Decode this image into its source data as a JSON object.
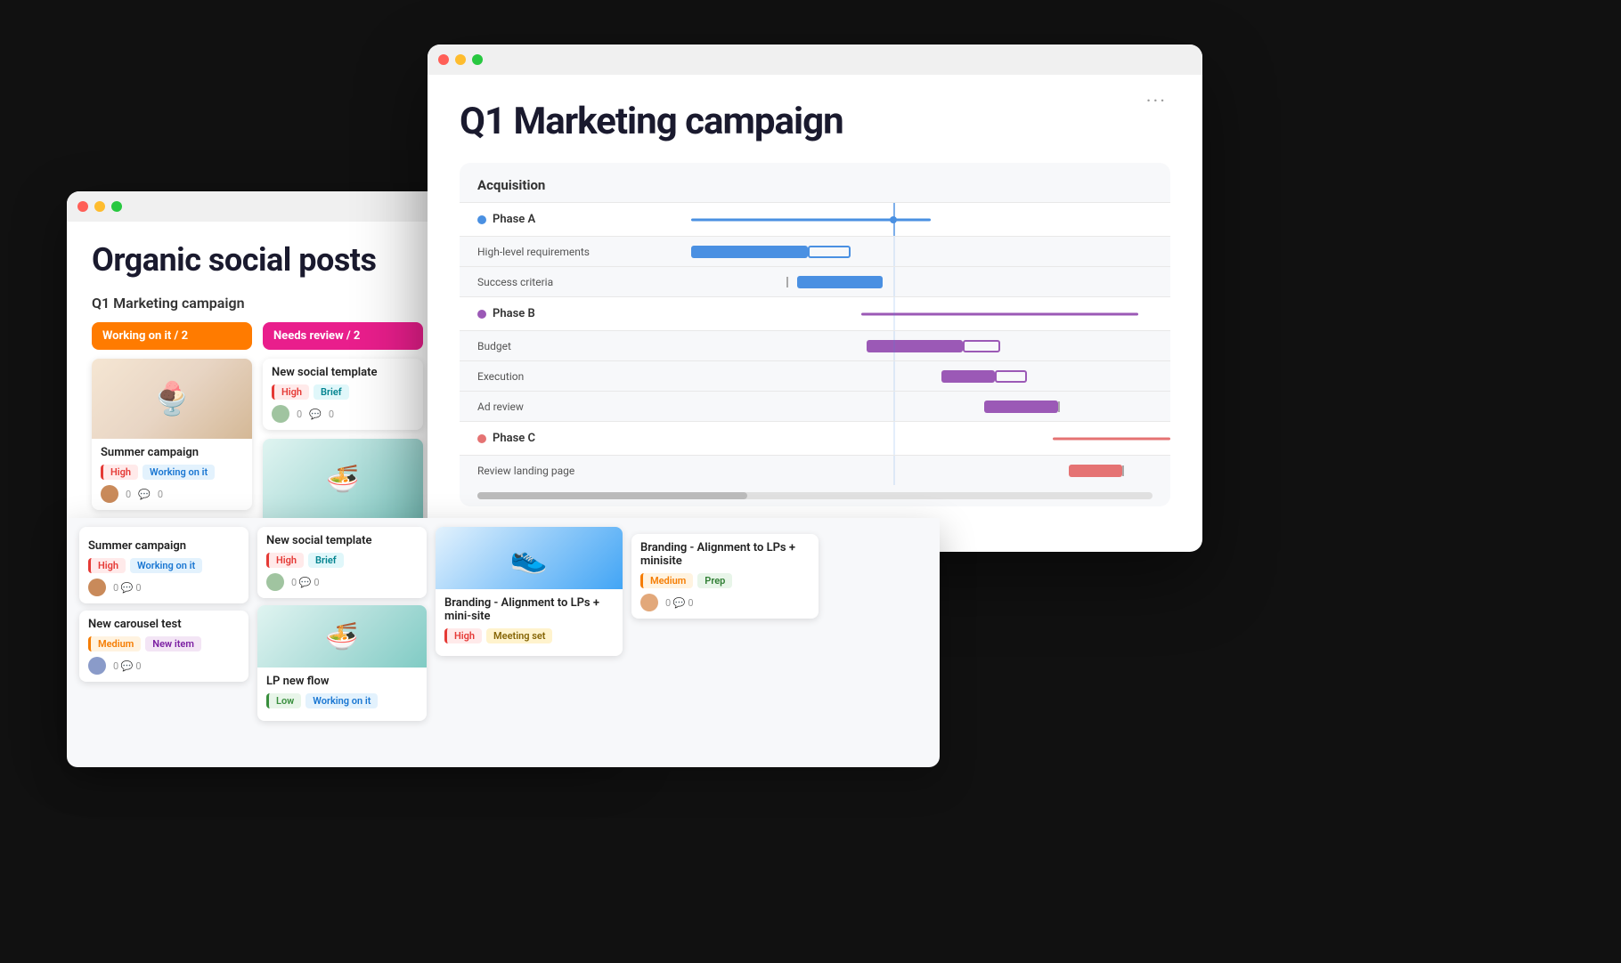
{
  "back_window": {
    "title": "Organic social posts",
    "board_title": "Q1 Marketing campaign",
    "col1": {
      "header": "Working on it / 2",
      "cards": [
        {
          "title": "Summer campaign",
          "img_type": "ice-cream",
          "tags": [
            "High",
            "Working on it"
          ]
        },
        {
          "title": "New carousel test",
          "img_type": "none",
          "tags": [
            "Medium",
            "New item"
          ]
        }
      ]
    },
    "col2": {
      "header": "Needs review / 2",
      "cards": [
        {
          "title": "New social template",
          "img_type": "none",
          "tags": [
            "High",
            "Brief"
          ]
        },
        {
          "title": "LP new flow",
          "img_type": "food",
          "tags": [
            "Low",
            "Working on it"
          ]
        }
      ]
    },
    "col3": {
      "cards": [
        {
          "title": "Branding - Alignment to LPs + mini-site",
          "img_type": "shoe",
          "tags": [
            "High",
            "Meeting set"
          ]
        },
        {
          "title": "Branding - Alignment to LPs + minisite",
          "img_type": "none",
          "tags": [
            "Medium",
            "Prep"
          ]
        }
      ]
    }
  },
  "front_window": {
    "title": "Q1 Marketing campaign",
    "menu_dots": "···",
    "gantt": {
      "section": "Acquisition",
      "phases": [
        {
          "id": "A",
          "label": "Phase A",
          "color": "#4a90e2",
          "items": [
            "High-level requirements",
            "Success criteria"
          ]
        },
        {
          "id": "B",
          "label": "Phase B",
          "color": "#9b59b6",
          "items": [
            "Budget",
            "Execution",
            "Ad review"
          ]
        },
        {
          "id": "C",
          "label": "Phase C",
          "color": "#e57373",
          "items": [
            "Review landing page"
          ]
        }
      ]
    }
  }
}
